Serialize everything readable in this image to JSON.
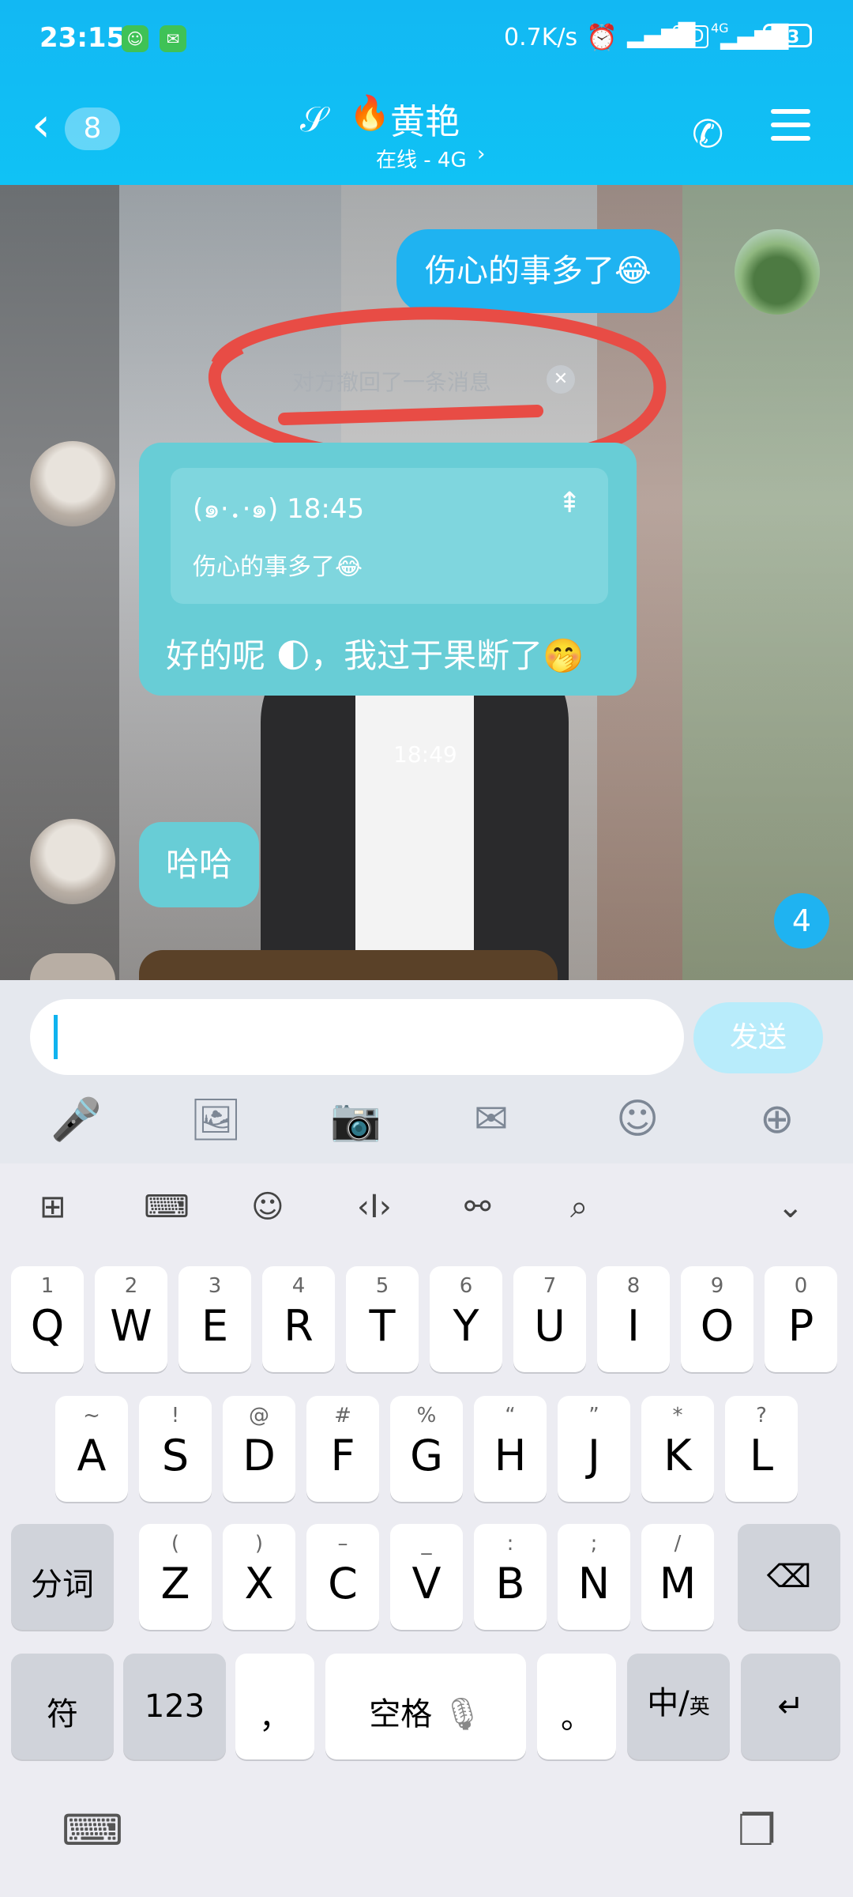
{
  "status_bar": {
    "time": "23:15",
    "net_speed": "0.7K/s",
    "signal_label": "HD",
    "net_type": "4G",
    "battery": "63"
  },
  "header": {
    "back_icon": "chevron-left-icon",
    "unread_count": "8",
    "title": "黄艳",
    "title_emoji": "🔥",
    "subtitle": "在线 - 4G",
    "ear_icon": "ear-icon",
    "call_icon": "phone-icon",
    "menu_icon": "menu-icon"
  },
  "messages": {
    "sent_text": "伤心的事多了😂",
    "recall_notice": "对方撤回了一条消息",
    "reply_quote_time": "(๑•̀ㅂ•́)و✧ 18:45",
    "reply_quote_prefix": "(๑·．·๑)",
    "reply_quote_clock": "18:45",
    "reply_quote_text": "伤心的事多了😂",
    "reply_text": "好的呢 🌓，我过于果断了🤭",
    "timestamp": "18:49",
    "haha_text": "哈哈",
    "unread_bubble": "4"
  },
  "input": {
    "placeholder": "",
    "send_label": "发送"
  },
  "toolbar": [
    "voice-icon",
    "image-icon",
    "camera-icon",
    "redpacket-icon",
    "emoji-icon",
    "plus-icon"
  ],
  "keyboard": {
    "row1": [
      {
        "n": "1",
        "l": "Q"
      },
      {
        "n": "2",
        "l": "W"
      },
      {
        "n": "3",
        "l": "E"
      },
      {
        "n": "4",
        "l": "R"
      },
      {
        "n": "5",
        "l": "T"
      },
      {
        "n": "6",
        "l": "Y"
      },
      {
        "n": "7",
        "l": "U"
      },
      {
        "n": "8",
        "l": "I"
      },
      {
        "n": "9",
        "l": "O"
      },
      {
        "n": "0",
        "l": "P"
      }
    ],
    "row2": [
      {
        "n": "~",
        "l": "A"
      },
      {
        "n": "!",
        "l": "S"
      },
      {
        "n": "@",
        "l": "D"
      },
      {
        "n": "#",
        "l": "F"
      },
      {
        "n": "%",
        "l": "G"
      },
      {
        "n": "“",
        "l": "H"
      },
      {
        "n": "”",
        "l": "J"
      },
      {
        "n": "*",
        "l": "K"
      },
      {
        "n": "?",
        "l": "L"
      }
    ],
    "row3": [
      {
        "n": "(",
        "l": "Z"
      },
      {
        "n": ")",
        "l": "X"
      },
      {
        "n": "–",
        "l": "C"
      },
      {
        "n": "_",
        "l": "V"
      },
      {
        "n": ":",
        "l": "B"
      },
      {
        "n": ";",
        "l": "N"
      },
      {
        "n": "/",
        "l": "M"
      }
    ],
    "fenci": "分词",
    "fu": "符",
    "num123": "123",
    "comma": "，",
    "space": "空格",
    "period": "。",
    "zh": "中",
    "en": "英",
    "enter": "↵"
  }
}
